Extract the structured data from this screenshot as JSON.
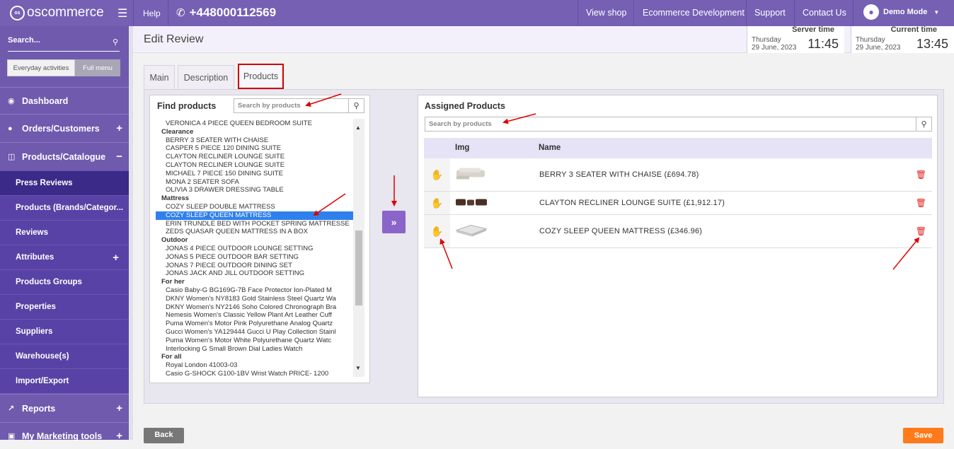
{
  "topbar": {
    "logo_text": "oscommerce",
    "logo_badge": "os",
    "help": "Help",
    "phone": "+448000112569",
    "links": [
      "View shop",
      "Ecommerce Development",
      "Support",
      "Contact Us"
    ],
    "user": "Demo Mode",
    "bg_color": "#7560b4"
  },
  "sidebar": {
    "search_placeholder": "Search...",
    "tabs": [
      "Everyday activities",
      "Full menu"
    ],
    "top_items": [
      {
        "label": "Dashboard",
        "icon": "dashboard-icon",
        "toggle": ""
      },
      {
        "label": "Orders/Customers",
        "icon": "users-icon",
        "toggle": "+"
      },
      {
        "label": "Products/Catalogue",
        "icon": "folder-icon",
        "toggle": "−"
      }
    ],
    "sub_items": [
      {
        "label": "Press Reviews",
        "toggle": ""
      },
      {
        "label": "Products (Brands/Categor...",
        "toggle": ""
      },
      {
        "label": "Reviews",
        "toggle": ""
      },
      {
        "label": "Attributes",
        "toggle": "+"
      },
      {
        "label": "Products Groups",
        "toggle": ""
      },
      {
        "label": "Properties",
        "toggle": ""
      },
      {
        "label": "Suppliers",
        "toggle": ""
      },
      {
        "label": "Warehouse(s)",
        "toggle": ""
      },
      {
        "label": "Import/Export",
        "toggle": ""
      }
    ],
    "bottom_items": [
      {
        "label": "Reports",
        "icon": "chart-icon",
        "toggle": "+"
      },
      {
        "label": "My Marketing tools",
        "icon": "cart-icon",
        "toggle": "+"
      }
    ]
  },
  "header": {
    "title": "Edit Review",
    "server_time": {
      "label": "Server time",
      "day": "Thursday",
      "date": "29 June, 2023",
      "time": "11:45"
    },
    "current_time": {
      "label": "Current time",
      "day": "Thursday",
      "date": "29 June, 2023",
      "time": "13:45"
    }
  },
  "tabs": [
    "Main",
    "Description",
    "Products"
  ],
  "find_products": {
    "title": "Find products",
    "search_placeholder": "Search by products",
    "list": [
      {
        "type": "item",
        "text": "VERONICA 4 PIECE QUEEN BEDROOM SUITE"
      },
      {
        "type": "group",
        "text": "Clearance"
      },
      {
        "type": "item",
        "text": "BERRY 3 SEATER WITH CHAISE"
      },
      {
        "type": "item",
        "text": "CASPER 5 PIECE 120 DINING SUITE"
      },
      {
        "type": "item",
        "text": "CLAYTON RECLINER LOUNGE SUITE"
      },
      {
        "type": "item",
        "text": "CLAYTON RECLINER LOUNGE SUITE"
      },
      {
        "type": "item",
        "text": "MICHAEL 7 PIECE 150 DINING SUITE"
      },
      {
        "type": "item",
        "text": "MONA 2 SEATER SOFA"
      },
      {
        "type": "item",
        "text": "OLIVIA 3 DRAWER DRESSING TABLE"
      },
      {
        "type": "group",
        "text": "Mattress"
      },
      {
        "type": "item",
        "text": "COZY SLEEP DOUBLE MATTRESS"
      },
      {
        "type": "item",
        "text": "COZY SLEEP QUEEN MATTRESS",
        "selected": true
      },
      {
        "type": "item",
        "text": "ERIN TRUNDLE BED WITH POCKET SPRING MATTRESSE"
      },
      {
        "type": "item",
        "text": "ZEDS QUASAR QUEEN MATTRESS IN A BOX"
      },
      {
        "type": "group",
        "text": "Outdoor"
      },
      {
        "type": "item",
        "text": "JONAS 4 PIECE OUTDOOR LOUNGE SETTING"
      },
      {
        "type": "item",
        "text": "JONAS 5 PIECE OUTDOOR BAR SETTING"
      },
      {
        "type": "item",
        "text": "JONAS 7 PIECE OUTDOOR DINING SET"
      },
      {
        "type": "item",
        "text": "JONAS JACK AND JILL OUTDOOR SETTING"
      },
      {
        "type": "group",
        "text": "For her"
      },
      {
        "type": "item",
        "text": "Casio Baby-G BG169G-7B Face Protector Ion-Plated M"
      },
      {
        "type": "item",
        "text": "DKNY Women's NY8183 Gold Stainless Steel Quartz Wa"
      },
      {
        "type": "item",
        "text": "DKNY Women's NY2146 Soho Colored Chronograph Bra"
      },
      {
        "type": "item",
        "text": "Nemesis Women's Classic Yellow Plant Art Leather Cuff"
      },
      {
        "type": "item",
        "text": "Puma Women's Motor Pink Polyurethane Analog Quartz"
      },
      {
        "type": "item",
        "text": "Gucci Women's YA129444 Gucci U Play Collection Stainl"
      },
      {
        "type": "item",
        "text": "Puma Women's Motor White Polyurethane Quartz Watc"
      },
      {
        "type": "item",
        "text": "Interlocking G Small Brown Dial Ladies Watch"
      },
      {
        "type": "group",
        "text": "For all"
      },
      {
        "type": "item",
        "text": "Royal London 41003-03"
      },
      {
        "type": "item",
        "text": "Casio G-SHOCK G100-1BV Wrist Watch PRICE- 1200"
      }
    ]
  },
  "move_button_icon": "double-chevron-right-icon",
  "assigned": {
    "title": "Assigned Products",
    "search_placeholder": "Search by products",
    "columns": [
      "Img",
      "Name"
    ],
    "rows": [
      {
        "name": "BERRY 3 SEATER WITH CHAISE (£694.78)",
        "img": "sofa-thumbnail"
      },
      {
        "name": "CLAYTON RECLINER LOUNGE SUITE (£1,912.17)",
        "img": "recliner-thumbnail"
      },
      {
        "name": "COZY SLEEP QUEEN MATTRESS (£346.96)",
        "img": "mattress-thumbnail"
      }
    ]
  },
  "buttons": {
    "back": "Back",
    "save": "Save"
  },
  "colors": {
    "accent": "#7560b4",
    "sidebar_active": "#3b2a88",
    "save": "#ff7a1a",
    "delete": "#e02020",
    "selection": "#2f80ed",
    "annotation": "#e00000"
  }
}
